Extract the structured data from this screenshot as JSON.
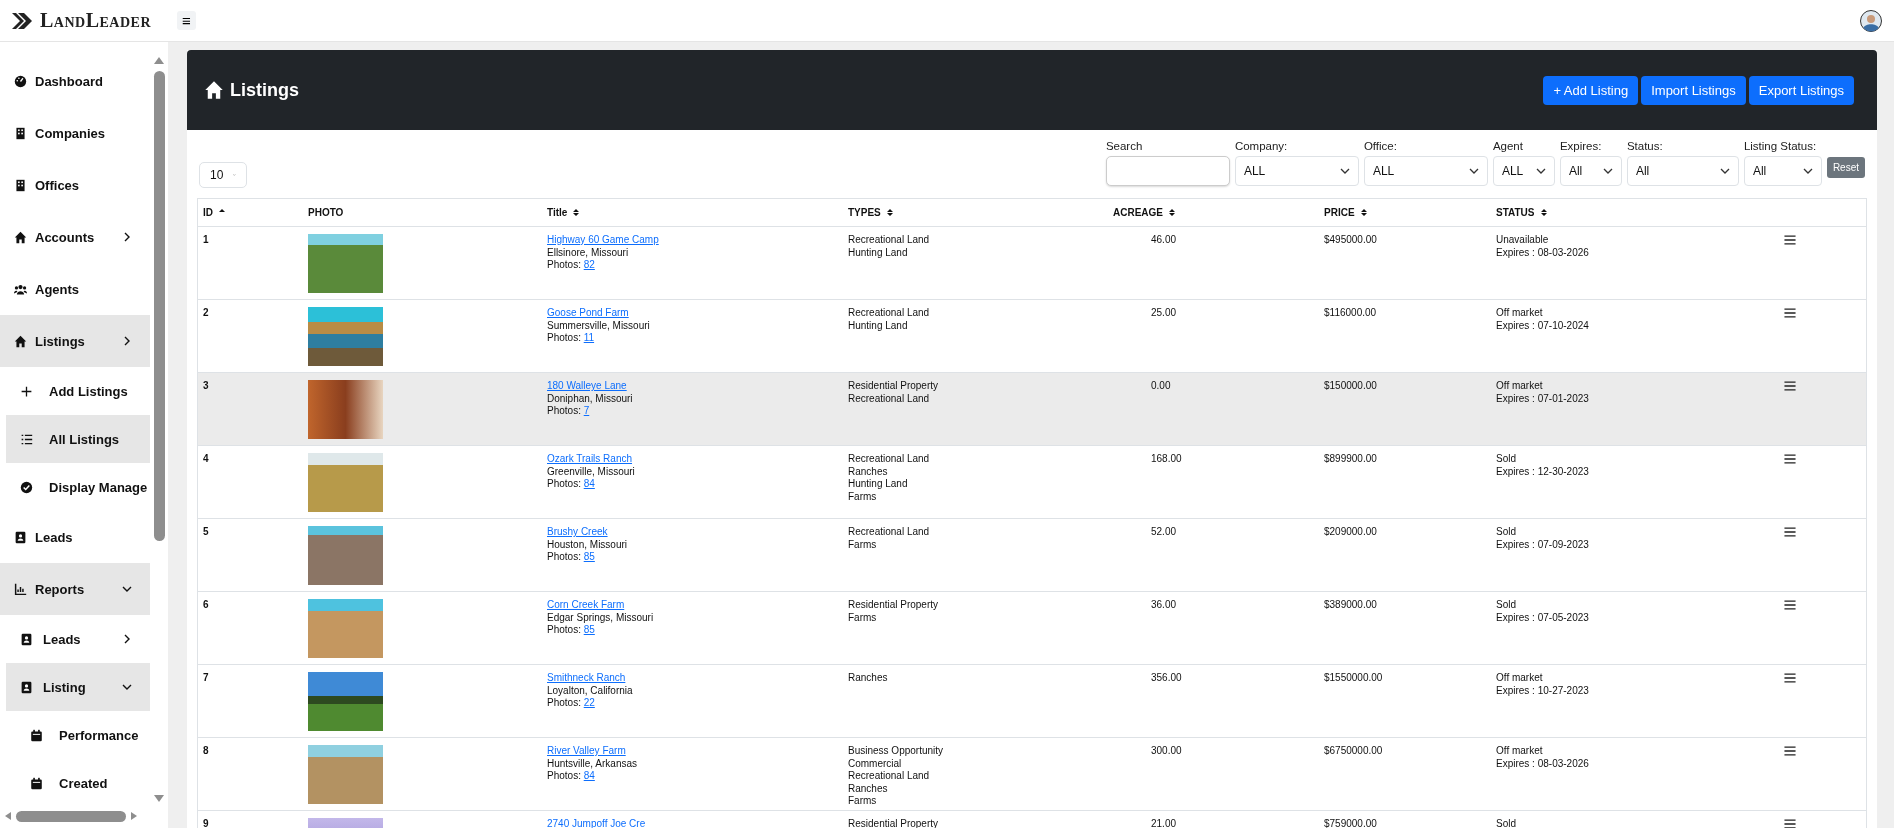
{
  "topbar": {
    "logo": "LandLeader",
    "menu_button": "≡"
  },
  "sidebar": {
    "items": [
      {
        "label": "Dashboard",
        "selected": false
      },
      {
        "label": "Companies",
        "selected": false
      },
      {
        "label": "Offices",
        "selected": false
      },
      {
        "label": "Accounts",
        "selected": false,
        "expanded": false
      },
      {
        "label": "Agents",
        "selected": false
      },
      {
        "label": "Listings",
        "selected": true,
        "expanded": false,
        "children": [
          {
            "label": "Add Listings",
            "selected": false
          },
          {
            "label": "All Listings",
            "selected": true
          },
          {
            "label": "Display Manage",
            "selected": false
          }
        ]
      },
      {
        "label": "Leads",
        "selected": false
      },
      {
        "label": "Reports",
        "selected": true,
        "expanded": true,
        "children": [
          {
            "label": "Leads",
            "selected": false,
            "expanded": false
          },
          {
            "label": "Listing",
            "selected": true,
            "expanded": true,
            "children": [
              {
                "label": "Performance",
                "selected": false
              },
              {
                "label": "Created",
                "selected": false
              }
            ]
          }
        ]
      }
    ]
  },
  "page": {
    "title": "Listings",
    "buttons": [
      "+ Add Listing",
      "Import Listings",
      "Export Listings"
    ]
  },
  "filters": {
    "page_size": "10",
    "fields": [
      {
        "kind": "text",
        "label": "Search"
      },
      {
        "kind": "select",
        "label": "Company:",
        "value": "ALL"
      },
      {
        "kind": "select",
        "label": "Office:",
        "value": "ALL"
      },
      {
        "kind": "select",
        "label": "Agent",
        "value": "ALL"
      },
      {
        "kind": "select",
        "label": "Expires:",
        "value": "All"
      },
      {
        "kind": "select",
        "label": "Status:",
        "value": "All"
      },
      {
        "kind": "select",
        "label": "Listing Status:",
        "value": "All"
      }
    ],
    "reset": "Reset"
  },
  "table": {
    "columns": [
      {
        "label": "ID",
        "kind": "ascending"
      },
      {
        "label": "PHOTO",
        "kind": "plain"
      },
      {
        "label": "Title",
        "kind": "sortable"
      },
      {
        "label": "TYPES",
        "kind": "sortable"
      },
      {
        "label": "ACREAGE",
        "kind": "sortable"
      },
      {
        "label": "PRICE",
        "kind": "sortable"
      },
      {
        "label": "STATUS",
        "kind": "sortable"
      }
    ],
    "rows": [
      {
        "id": "1",
        "highlighted": false,
        "title": "Highway 60 Game Camp",
        "location": "Ellsinore, Missouri",
        "photos_label": "Photos:",
        "photos": "82",
        "types": [
          "Recreational Land",
          "Hunting Land"
        ],
        "acreage": "46.00",
        "price": "$495000.00",
        "status": "Unavailable",
        "expires": "Expires : 08-03-2026"
      },
      {
        "id": "2",
        "highlighted": false,
        "title": "Goose Pond Farm",
        "location": "Summersville, Missouri",
        "photos_label": "Photos:",
        "photos": "11",
        "types": [
          "Recreational Land",
          "Hunting Land"
        ],
        "acreage": "25.00",
        "price": "$116000.00",
        "status": "Off market",
        "expires": "Expires : 07-10-2024"
      },
      {
        "id": "3",
        "highlighted": true,
        "title": "180 Walleye Lane",
        "location": "Doniphan, Missouri",
        "photos_label": "Photos:",
        "photos": "7",
        "types": [
          "Residential Property",
          "Recreational Land"
        ],
        "acreage": "0.00",
        "price": "$150000.00",
        "status": "Off market",
        "expires": "Expires : 07-01-2023"
      },
      {
        "id": "4",
        "highlighted": false,
        "title": "Ozark Trails Ranch",
        "location": "Greenville, Missouri",
        "photos_label": "Photos:",
        "photos": "84",
        "types": [
          "Recreational Land",
          "Ranches",
          "Hunting Land",
          "Farms"
        ],
        "acreage": "168.00",
        "price": "$899900.00",
        "status": "Sold",
        "expires": "Expires : 12-30-2023"
      },
      {
        "id": "5",
        "highlighted": false,
        "title": "Brushy Creek",
        "location": "Houston, Missouri",
        "photos_label": "Photos:",
        "photos": "85",
        "types": [
          "Recreational Land",
          "Farms"
        ],
        "acreage": "52.00",
        "price": "$209000.00",
        "status": "Sold",
        "expires": "Expires : 07-09-2023"
      },
      {
        "id": "6",
        "highlighted": false,
        "title": "Corn Creek Farm",
        "location": "Edgar Springs, Missouri",
        "photos_label": "Photos:",
        "photos": "85",
        "types": [
          "Residential Property",
          "Farms"
        ],
        "acreage": "36.00",
        "price": "$389000.00",
        "status": "Sold",
        "expires": "Expires : 07-05-2023"
      },
      {
        "id": "7",
        "highlighted": false,
        "title": "Smithneck Ranch",
        "location": "Loyalton, California",
        "photos_label": "Photos:",
        "photos": "22",
        "types": [
          "Ranches"
        ],
        "acreage": "356.00",
        "price": "$1550000.00",
        "status": "Off market",
        "expires": "Expires : 10-27-2023"
      },
      {
        "id": "8",
        "highlighted": false,
        "title": "River Valley Farm",
        "location": "Huntsville, Arkansas",
        "photos_label": "Photos:",
        "photos": "84",
        "types": [
          "Business Opportunity",
          "Commercial",
          "Recreational Land",
          "Ranches",
          "Farms"
        ],
        "acreage": "300.00",
        "price": "$6750000.00",
        "status": "Off market",
        "expires": "Expires : 08-03-2026"
      },
      {
        "id": "9",
        "highlighted": false,
        "title": "2740 Jumpoff Joe Cre",
        "types": [
          "Residential Property"
        ],
        "acreage": "21.00",
        "price": "$759000.00",
        "status": "Sold"
      }
    ]
  }
}
